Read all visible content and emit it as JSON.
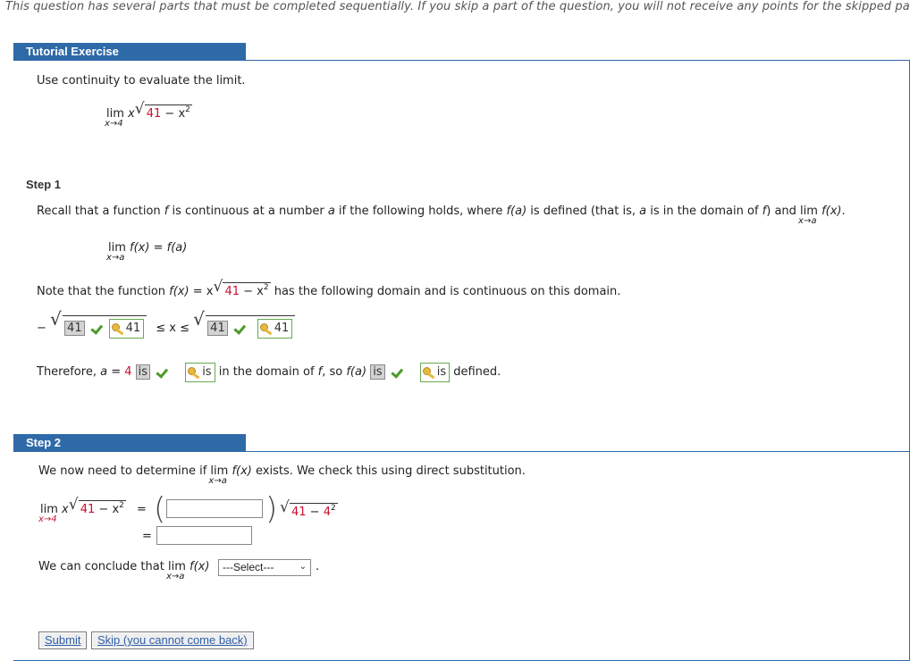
{
  "notice": "This question has several parts that must be completed sequentially. If you skip a part of the question, you will not receive any points for the skipped par",
  "tutorial": {
    "header": "Tutorial Exercise",
    "instruction": "Use continuity to evaluate the limit.",
    "lim": "lim",
    "lim_sub": "x→4",
    "x": "x",
    "radicand_num": "41",
    "radicand_rest": " − x",
    "exp": "2"
  },
  "step1": {
    "title": "Step 1",
    "recall_a": "Recall that a function ",
    "recall_f": "f",
    "recall_b": " is continuous at a number ",
    "recall_a_var": "a",
    "recall_c": " if the following holds, where ",
    "recall_fa": "f(a)",
    "recall_d": " is defined (that is, ",
    "recall_e": " is in the domain of ",
    "recall_f2": "f",
    "recall_g": ") and ",
    "lim": "lim",
    "lim_sub_a": "x→a",
    "fx": "f(x)",
    "recall_end": ".",
    "def_lhs": "f(x)",
    "def_eq": " = ",
    "def_rhs": "f(a)",
    "note_a": "Note that the function ",
    "note_fx": "f(x)",
    "note_eq": " = x",
    "note_num": "41",
    "note_rest": " − x",
    "note_exp": "2",
    "note_b": " has the following domain and is continuous on this domain.",
    "domain_minus": "−",
    "domain_ans1": "41",
    "domain_key1": "41",
    "domain_ineq": "≤ x ≤",
    "domain_ans2": "41",
    "domain_key2": "41",
    "therefore": "Therefore, ",
    "a_var": "a",
    "a_eq": " = ",
    "a_val": "4",
    "is_ans1": "is",
    "is_key1": "is",
    "in_domain_a": " in the domain of ",
    "in_domain_f": "f",
    "in_domain_b": ", so ",
    "fa": "f(a)",
    "is_ans2": "is",
    "is_key2": "is",
    "defined": " defined."
  },
  "step2": {
    "title": "Step 2",
    "intro_a": "We now need to determine if ",
    "lim": "lim",
    "lim_sub_a": "x→a",
    "fx": "f(x)",
    "intro_b": " exists. We check this using direct substitution.",
    "lim_sub_4": "x→4",
    "x": "x",
    "rad_num": "41",
    "rad_rest": " − x",
    "exp": "2",
    "eq": "=",
    "rhs_num": "41",
    "rhs_rest": " − ",
    "rhs_four": "4",
    "rhs_exp": "2",
    "eq2": "=",
    "conclude": "We can conclude that ",
    "conclude_fx": "f(x)",
    "select_value": "---Select---",
    "period": "."
  },
  "buttons": {
    "submit": "Submit",
    "skip": "Skip (you cannot come back)"
  },
  "colors": {
    "accent": "#2f6aa8",
    "red_number": "#c8102e",
    "check": "#4c9a2a"
  }
}
